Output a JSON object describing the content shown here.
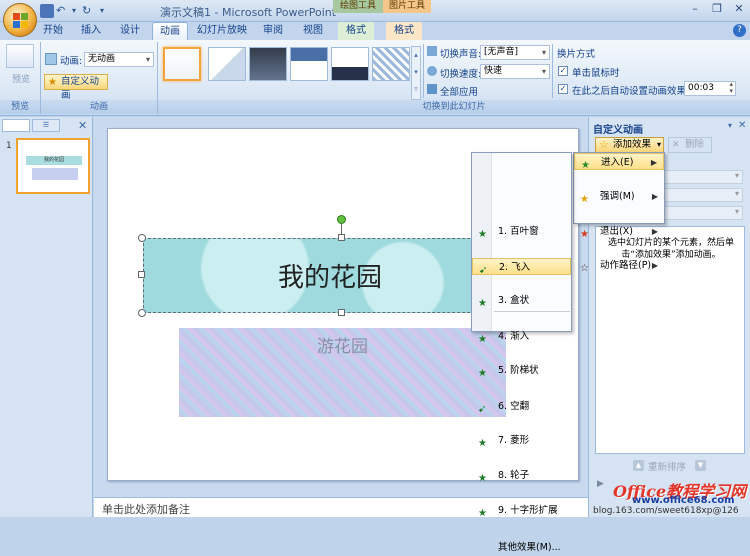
{
  "window": {
    "title": "演示文稿1 - Microsoft PowerPoint",
    "context_tabs": [
      "绘图工具",
      "图片工具"
    ]
  },
  "tabs": [
    "开始",
    "插入",
    "设计",
    "动画",
    "幻灯片放映",
    "审阅",
    "视图",
    "格式",
    "格式"
  ],
  "active_tab": "动画",
  "ribbon": {
    "preview": {
      "label": "预览",
      "group": "预览"
    },
    "animation": {
      "label": "动画:",
      "value": "无动画",
      "custom_button": "自定义动画",
      "group": "动画"
    },
    "transition": {
      "sound_label": "切换声音:",
      "sound_value": "[无声音]",
      "speed_label": "切换速度:",
      "speed_value": "快速",
      "apply_all": "全部应用",
      "group": "切换到此幻灯片"
    },
    "advance": {
      "title": "换片方式",
      "on_click": "单击鼠标时",
      "after_time": "在此之后自动设置动画效果:",
      "time_value": "00:03"
    }
  },
  "slide": {
    "title": "我的花园",
    "subtitle": "游花园",
    "thumb_title": "我的花园",
    "number": "1"
  },
  "notes_placeholder": "单击此处添加备注",
  "taskpane": {
    "title": "自定义动画",
    "add_effect": "添加效果",
    "remove": "删除",
    "hint": "选中幻灯片的某个元素，然后单击“添加效果”添加动画。",
    "reorder": "重新排序"
  },
  "menu_categories": [
    {
      "label": "进入(E)",
      "icon": "star-green-icon"
    },
    {
      "label": "强调(M)",
      "icon": "star-yellow-icon"
    },
    {
      "label": "退出(X)",
      "icon": "star-red-icon"
    },
    {
      "label": "动作路径(P)",
      "icon": "star-outline-icon"
    }
  ],
  "menu_entrance": [
    "1. 百叶窗",
    "2. 飞入",
    "3. 盒状",
    "4. 渐入",
    "5. 阶梯状",
    "6. 空翻",
    "7. 菱形",
    "8. 轮子",
    "9. 十字形扩展",
    "其他效果(M)..."
  ],
  "watermark": {
    "brand": "Office教程学习网",
    "url": "www.office68.com",
    "blog": "blog.163.com/sweet618xp@126"
  }
}
